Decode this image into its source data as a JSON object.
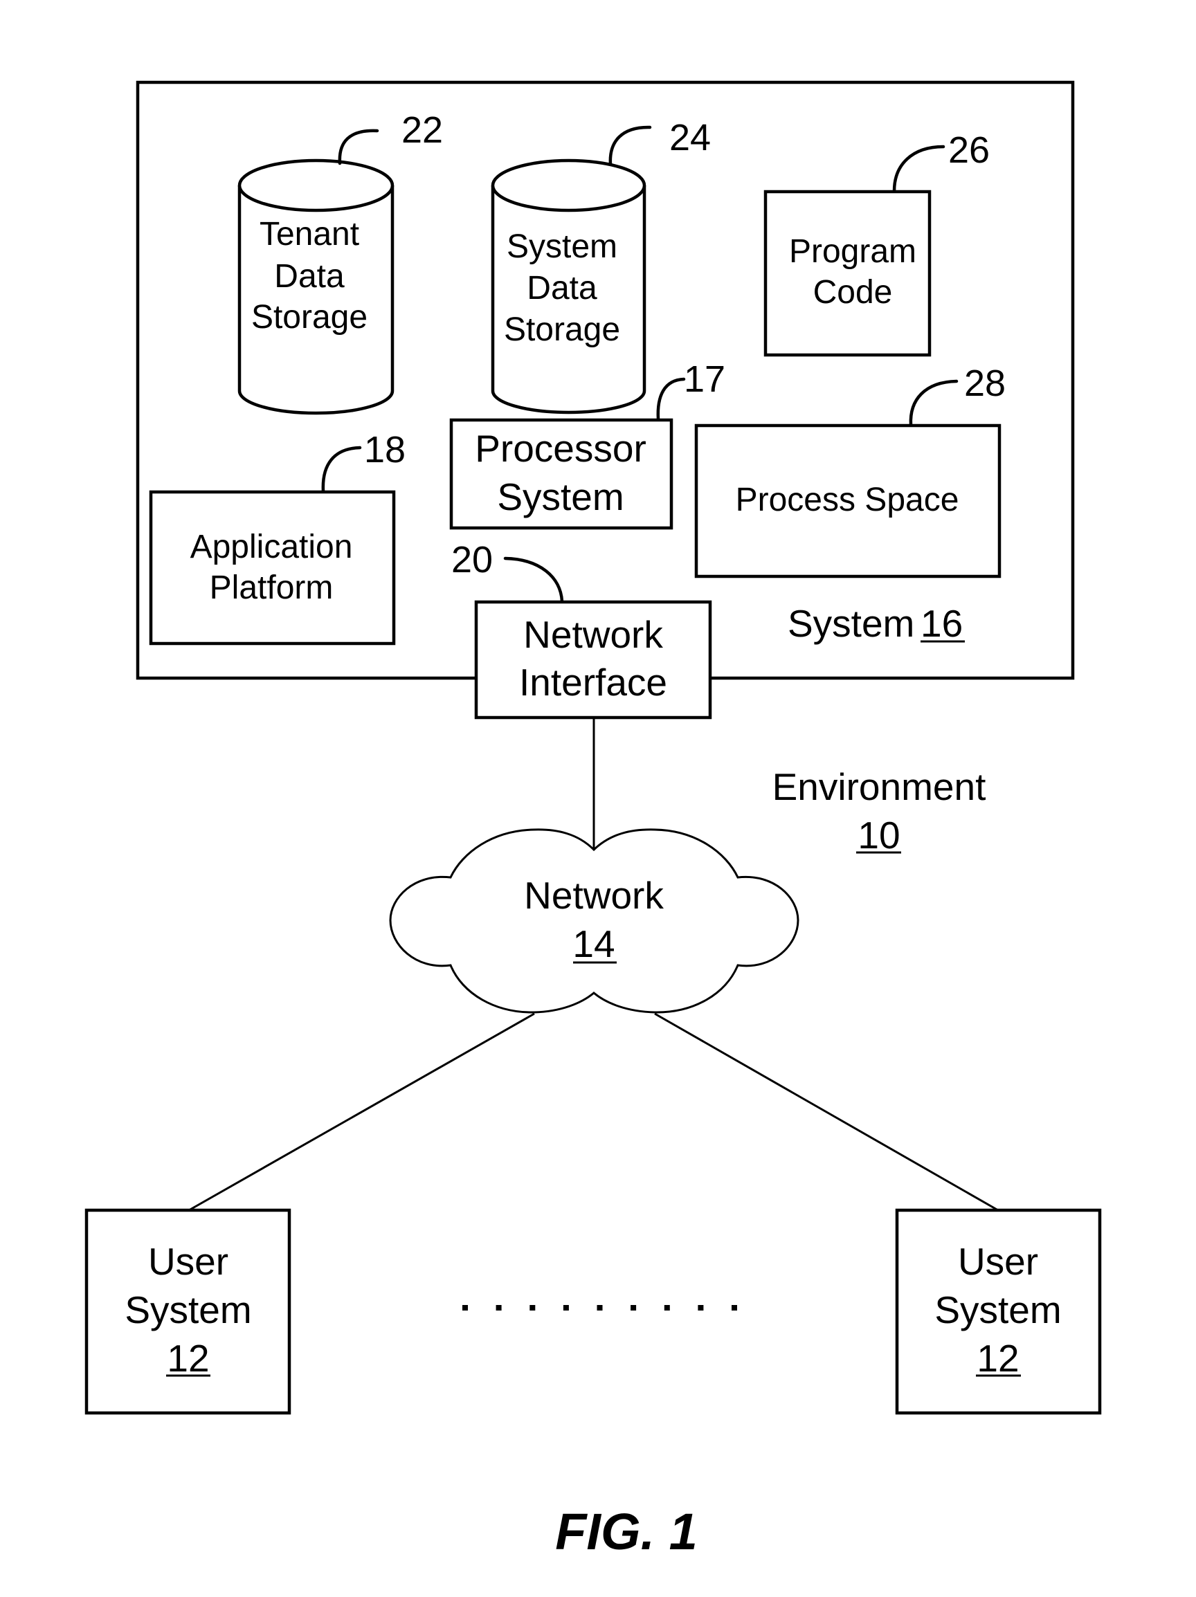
{
  "figure": {
    "caption": "FIG. 1",
    "environment": {
      "label": "Environment",
      "ref": "10"
    },
    "system": {
      "label": "System",
      "ref": "16"
    },
    "components": {
      "tenant_data_storage": {
        "lines": [
          "Tenant",
          "Data",
          "Storage"
        ],
        "ref": "22",
        "shape": "cylinder"
      },
      "system_data_storage": {
        "lines": [
          "System",
          "Data",
          "Storage"
        ],
        "ref": "24",
        "shape": "cylinder"
      },
      "program_code": {
        "lines": [
          "Program",
          "Code"
        ],
        "ref": "26",
        "shape": "box"
      },
      "processor_system": {
        "lines": [
          "Processor",
          "System"
        ],
        "ref": "17",
        "shape": "box"
      },
      "process_space": {
        "lines": [
          "Process Space"
        ],
        "ref": "28",
        "shape": "box"
      },
      "application_platform": {
        "lines": [
          "Application",
          "Platform"
        ],
        "ref": "18",
        "shape": "box"
      },
      "network_interface": {
        "lines": [
          "Network",
          "Interface"
        ],
        "ref": "20",
        "shape": "box"
      }
    },
    "network": {
      "label": "Network",
      "ref": "14",
      "shape": "cloud"
    },
    "user_systems": [
      {
        "lines": [
          "User",
          "System"
        ],
        "ref": "12"
      },
      {
        "lines": [
          "User",
          "System"
        ],
        "ref": "12"
      }
    ],
    "ellipsis_dot_count": 9,
    "colors": {
      "stroke": "#000000",
      "background": "#ffffff"
    }
  }
}
